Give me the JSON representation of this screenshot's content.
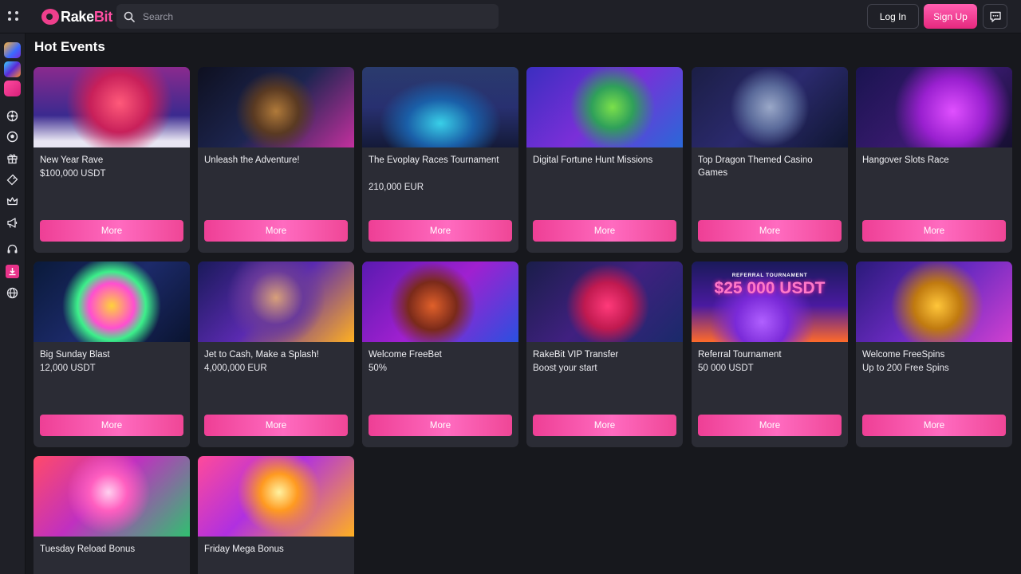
{
  "app": {
    "logo_text_a": "Rake",
    "logo_text_b": "Bit"
  },
  "header": {
    "search_placeholder": "Search",
    "login_label": "Log In",
    "signup_label": "Sign Up"
  },
  "sidebar": {
    "games": [
      "game-thumbnail-1",
      "game-thumbnail-2",
      "game-thumbnail-3"
    ],
    "icons": [
      "casino-icon",
      "sports-icon",
      "gift-icon",
      "ticket-icon",
      "crown-icon",
      "megaphone-icon",
      "headset-icon",
      "download-icon",
      "globe-icon"
    ]
  },
  "main": {
    "title": "Hot Events",
    "more_label": "More",
    "cards": [
      {
        "title": "New Year Rave",
        "subtitle": "$100,000 USDT"
      },
      {
        "title": "Unleash the Adventure!",
        "subtitle": ""
      },
      {
        "title": "The Evoplay Races Tournament",
        "subtitle": "210,000 EUR"
      },
      {
        "title": "Digital Fortune Hunt Missions",
        "subtitle": ""
      },
      {
        "title": "Top Dragon Themed Casino Games",
        "subtitle": ""
      },
      {
        "title": "Hangover Slots Race",
        "subtitle": ""
      },
      {
        "title": "Big Sunday Blast",
        "subtitle": "12,000 USDT"
      },
      {
        "title": "Jet to Cash, Make a Splash!",
        "subtitle": "4,000,000 EUR"
      },
      {
        "title": "Welcome FreeBet",
        "subtitle": "50%"
      },
      {
        "title": "RakeBit VIP Transfer",
        "subtitle": "Boost your start"
      },
      {
        "title": "Referral Tournament",
        "subtitle": "50 000 USDT"
      },
      {
        "title": "Welcome FreeSpins",
        "subtitle": "Up to 200 Free Spins"
      },
      {
        "title": "Tuesday Reload Bonus",
        "subtitle": ""
      },
      {
        "title": "Friday Mega Bonus",
        "subtitle": ""
      }
    ],
    "referral_banner_small": "REFERRAL TOURNAMENT",
    "referral_banner_big": "$25 000 USDT"
  },
  "colors": {
    "accent": "#ee3f95",
    "background": "#17181d",
    "card": "#2b2c35"
  }
}
